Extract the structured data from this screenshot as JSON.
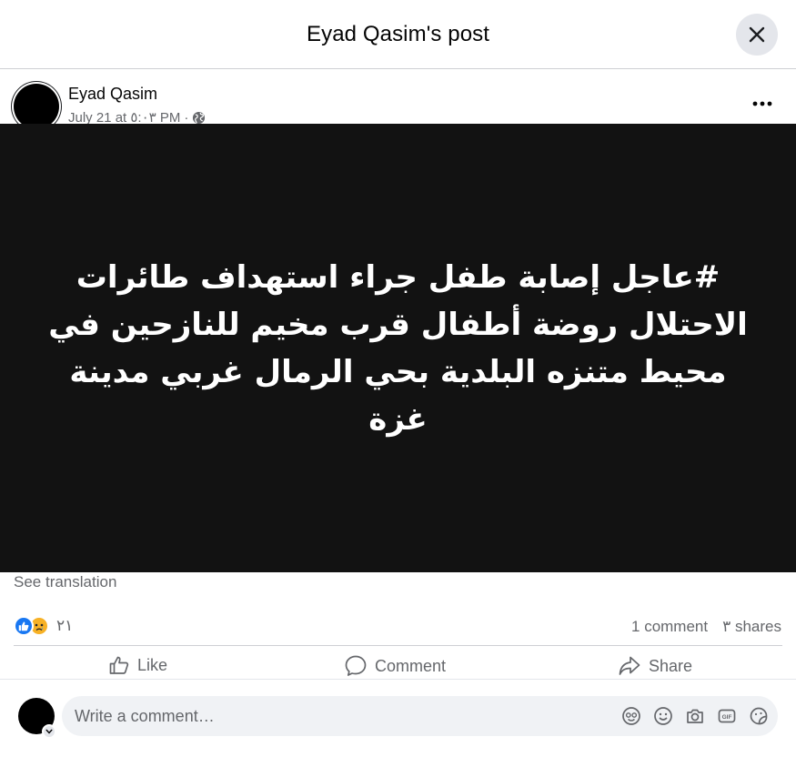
{
  "header": {
    "title": "Eyad Qasim's post",
    "close_icon": "close-icon"
  },
  "post": {
    "author": "Eyad Qasim",
    "date": "July 21 at ٥:٠٣ PM",
    "separator": "·",
    "audience_icon": "globe-icon",
    "more_icon": "more-dots-icon",
    "image_text": "#عاجل إصابة طفل جراء استهداف طائرات الاحتلال روضة أطفال قرب مخيم للنازحين في محيط متنزه البلدية بحي الرمال غربي مدينة غزة",
    "see_translation": "See translation"
  },
  "stats": {
    "reaction_icons": [
      "like-reaction-icon",
      "sad-reaction-icon"
    ],
    "reaction_count": "٢١",
    "comments": "1 comment",
    "shares": "٣ shares"
  },
  "actions": {
    "like": "Like",
    "comment": "Comment",
    "share": "Share"
  },
  "comment_box": {
    "placeholder": "Write a comment…",
    "tools": [
      "avatar-sticker-icon",
      "emoji-icon",
      "camera-icon",
      "gif-icon",
      "sticker-icon"
    ]
  },
  "colors": {
    "accent": "#1877f2",
    "muted_text": "#65676b",
    "image_bg": "#121212",
    "sad": "#f7b125"
  }
}
